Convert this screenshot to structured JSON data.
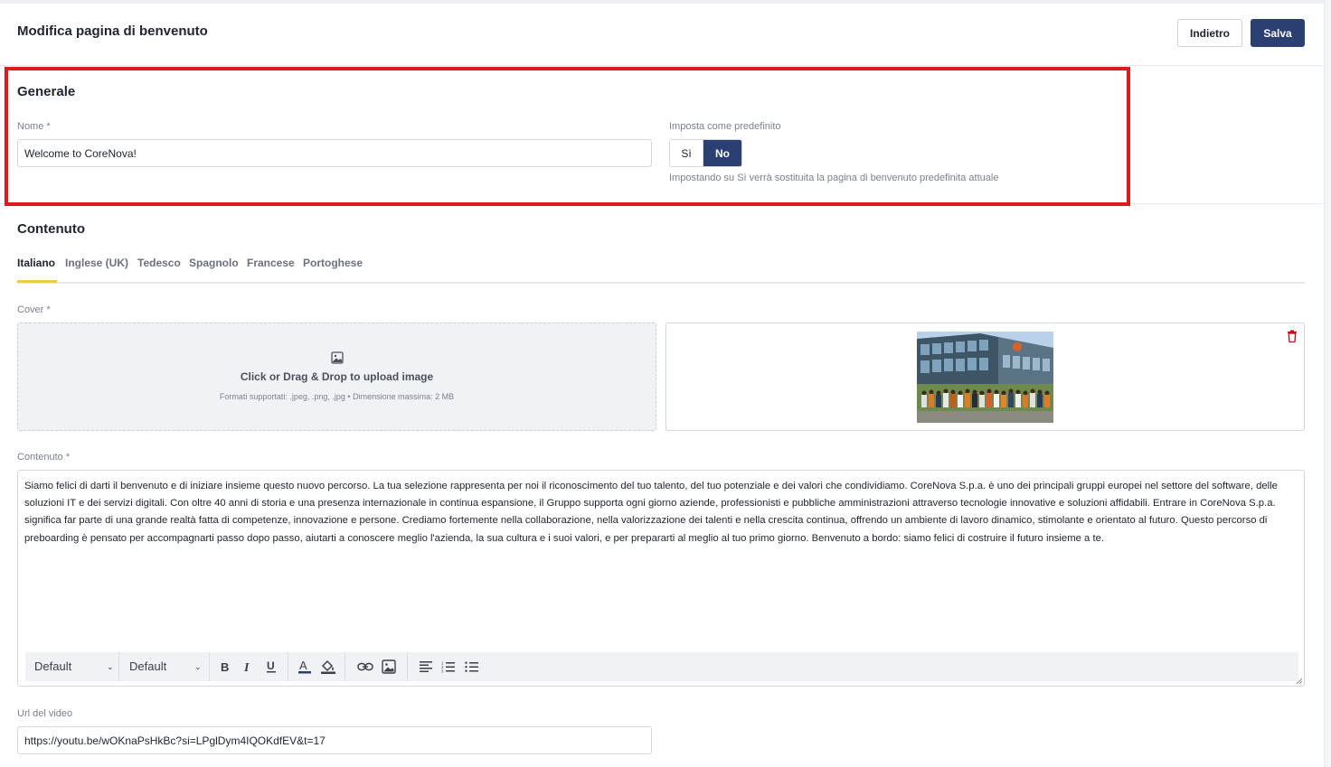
{
  "header": {
    "title": "Modifica pagina di benvenuto",
    "back_label": "Indietro",
    "save_label": "Salva"
  },
  "general": {
    "title": "Generale",
    "name_label": "Nome *",
    "name_value": "Welcome to CoreNova!",
    "default_label": "Imposta come predefinito",
    "toggle": {
      "yes": "Sì",
      "no": "No",
      "selected": "No"
    },
    "hint": "Impostando su Sì verrà sostituita la pagina di benvenuto predefinita attuale"
  },
  "content": {
    "title": "Contenuto",
    "tabs": [
      {
        "label": "Italiano",
        "active": true
      },
      {
        "label": "Inglese (UK)",
        "active": false
      },
      {
        "label": "Tedesco",
        "active": false
      },
      {
        "label": "Spagnolo",
        "active": false
      },
      {
        "label": "Francese",
        "active": false
      },
      {
        "label": "Portoghese",
        "active": false
      }
    ],
    "cover_label": "Cover *",
    "upload": {
      "icon": "image-icon",
      "title": "Click or Drag & Drop to upload image",
      "subtitle": "Formati supportati: .jpeg, .png, .jpg • Dimensione massima: 2 MB"
    },
    "preview": {
      "image": "office-building-group-photo",
      "delete_icon": "trash-icon"
    },
    "body_label": "Contenuto *",
    "body_text": "Siamo felici di darti il benvenuto e di iniziare insieme questo nuovo percorso. La tua selezione rappresenta per noi il riconoscimento del tuo talento, del tuo potenziale e dei valori che condividiamo. CoreNova S.p.a. è uno dei principali gruppi europei nel settore del software, delle soluzioni IT e dei servizi digitali. Con oltre 40 anni di storia e una presenza internazionale in continua espansione, il Gruppo supporta ogni giorno aziende, professionisti e pubbliche amministrazioni attraverso tecnologie innovative e soluzioni affidabili. Entrare in CoreNova S.p.a. significa far parte di una grande realtà fatta di competenze, innovazione e persone. Crediamo fortemente nella collaborazione, nella valorizzazione dei talenti e nella crescita continua, offrendo un ambiente di lavoro dinamico, stimolante e orientato al futuro. Questo percorso di preboarding è pensato per accompagnarti passo dopo passo, aiutarti a conoscere meglio l'azienda, la sua cultura e i suoi valori, e per prepararti al meglio al tuo primo giorno. Benvenuto a bordo: siamo felici di costruire il futuro insieme a te.",
    "toolbar": {
      "font_select": "Default",
      "size_select": "Default",
      "buttons": [
        "bold-icon",
        "italic-icon",
        "underline-icon",
        "font-color-icon",
        "highlight-icon",
        "link-icon",
        "image-icon",
        "align-left-icon",
        "ordered-list-icon",
        "bullet-list-icon"
      ]
    },
    "video_label": "Url del video",
    "video_value": "https://youtu.be/wOKnaPsHkBc?si=LPglDym4IQOKdfEV&t=17"
  },
  "colors": {
    "primary": "#2b3f73",
    "highlight_border": "#e0191e",
    "tab_accent": "#f2c84b",
    "delete": "#d0021b"
  }
}
